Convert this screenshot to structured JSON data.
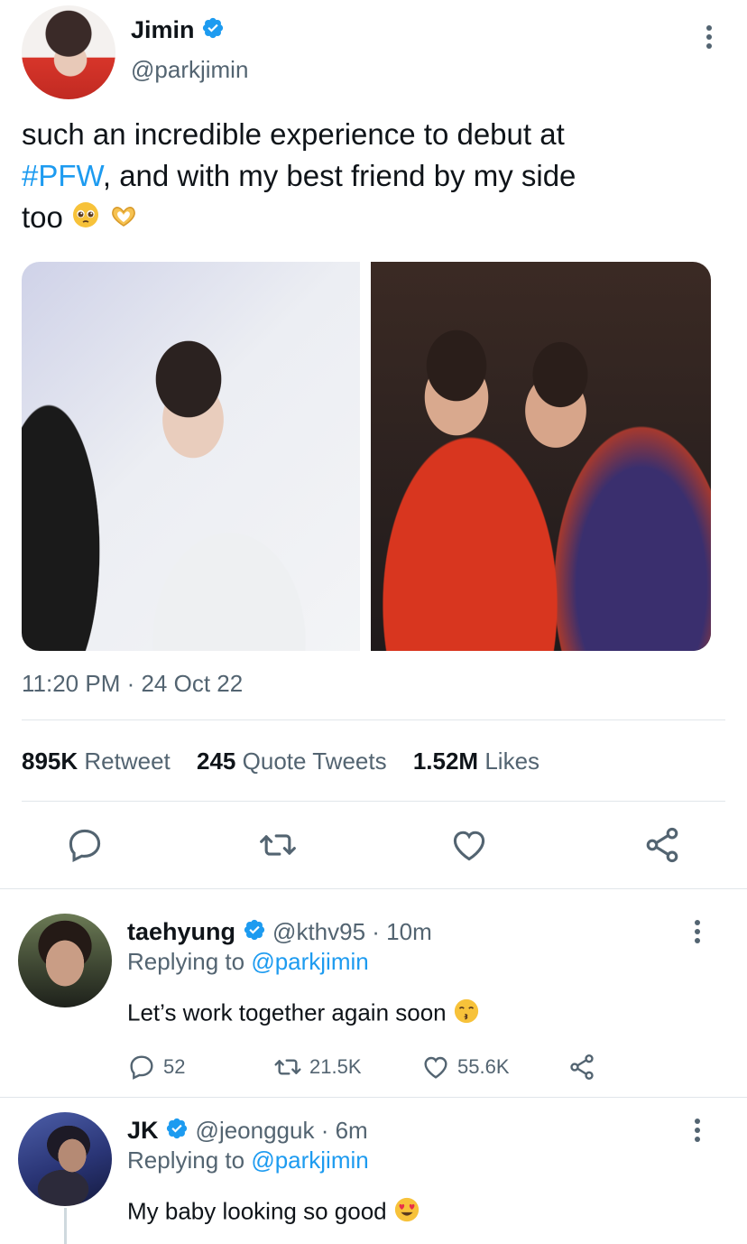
{
  "tweet": {
    "author_name": "Jimin",
    "author_handle": "@parkjimin",
    "text_part1": "such an incredible experience to debut at",
    "hashtag": "#PFW",
    "text_part2": ", and with my best friend by my side",
    "text_part3": "too",
    "emojis": [
      "pleading-face",
      "heart-hands"
    ],
    "timestamp": "11:20 PM · 24 Oct 22",
    "stats": {
      "retweets_count": "895K",
      "retweets_label": "Retweet",
      "quotes_count": "245",
      "quotes_label": "Quote Tweets",
      "likes_count": "1.52M",
      "likes_label": "Likes"
    },
    "actions": [
      "reply-icon",
      "retweet-icon",
      "like-icon",
      "share-icon"
    ]
  },
  "replies": [
    {
      "name": "taehyung",
      "meta": "@kthv95 · 10m",
      "replying_prefix": "Replying to",
      "replying_to": "@parkjimin",
      "text": "Let’s work together again soon",
      "emoji": "kissing-face",
      "reply_count": "52",
      "retweet_count": "21.5K",
      "like_count": "55.6K"
    },
    {
      "name": "JK",
      "meta": "@jeongguk · 6m",
      "replying_prefix": "Replying to",
      "replying_to": "@parkjimin",
      "text": "My baby looking so good",
      "emoji": "heart-eyes-face"
    }
  ],
  "colors": {
    "accent": "#1d9bf0",
    "secondary_text": "#536471",
    "primary_text": "#0f1419",
    "divider": "#e1e6ea"
  }
}
